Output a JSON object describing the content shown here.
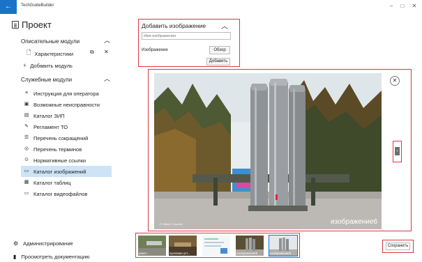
{
  "app": {
    "title": "TechGuideBuilder",
    "back_icon": "arrow-left-icon",
    "accent": "#1a73c9"
  },
  "window_controls": {
    "minimize": "–",
    "maximize": "□",
    "close": "✕"
  },
  "project": {
    "title": "Проект"
  },
  "descriptive": {
    "heading": "Описательные модули",
    "items": [
      {
        "label": "Характеристики"
      }
    ],
    "add_label": "Добавить модуль"
  },
  "service": {
    "heading": "Служебные модули",
    "items": [
      {
        "label": "Инструкция для оператора",
        "icon": "≡"
      },
      {
        "label": "Возможные неисправности",
        "icon": "▣"
      },
      {
        "label": "Каталог ЗИП",
        "icon": "▤"
      },
      {
        "label": "Регламент ТО",
        "icon": "✎"
      },
      {
        "label": "Перечень сокращений",
        "icon": "☰"
      },
      {
        "label": "Перечень терминов",
        "icon": "◎"
      },
      {
        "label": "Нормативные ссылки",
        "icon": "⊙"
      },
      {
        "label": "Каталог изображений",
        "icon": "▭"
      },
      {
        "label": "Каталог таблиц",
        "icon": "▦"
      },
      {
        "label": "Каталог видеофайлов",
        "icon": "▭"
      }
    ]
  },
  "bottom": {
    "admin": "Администрирование",
    "view_docs": "Просмотреть документацию"
  },
  "add_image": {
    "title": "Добавить изображение",
    "name_placeholder": "Имя изображения",
    "image_label": "Изображение",
    "browse": "Обзор",
    "add": "Добавить"
  },
  "preview": {
    "caption": "изображение6",
    "copyright": "© Vitaly V. Kuzmin",
    "close": "✕",
    "next": "›"
  },
  "thumbnails": [
    {
      "label": "ракет..."
    },
    {
      "label": "пусковая уст..."
    },
    {
      "label": ""
    },
    {
      "label": "изображение5"
    },
    {
      "label": "изображение6"
    }
  ],
  "save": "Сохранить",
  "colors": {
    "highlight": "#d9383f",
    "active_bg": "#cfe3f7"
  }
}
